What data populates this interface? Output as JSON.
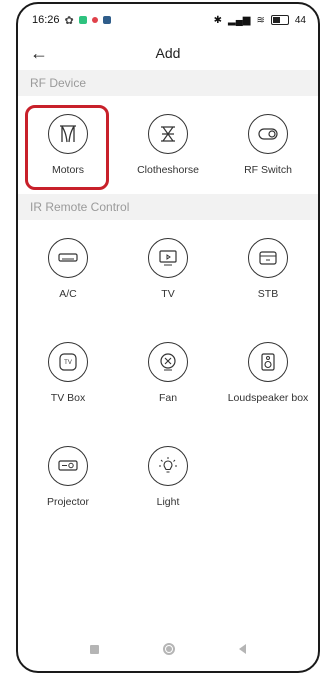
{
  "status_bar": {
    "time": "16:26",
    "battery": "44"
  },
  "header": {
    "back_icon": "arrow-left-icon",
    "title": "Add"
  },
  "rf_section": {
    "title": "RF Device",
    "items": [
      {
        "label": "Motors",
        "icon": "curtain-icon",
        "selected": true
      },
      {
        "label": "Clotheshorse",
        "icon": "clotheshorse-icon",
        "selected": false
      },
      {
        "label": "RF Switch",
        "icon": "switch-icon",
        "selected": false
      }
    ]
  },
  "ir_section": {
    "title": "IR Remote Control",
    "items": [
      {
        "label": "A/C",
        "icon": "ac-icon"
      },
      {
        "label": "TV",
        "icon": "tv-icon"
      },
      {
        "label": "STB",
        "icon": "stb-icon"
      },
      {
        "label": "TV Box",
        "icon": "tv-box-icon"
      },
      {
        "label": "Fan",
        "icon": "fan-icon"
      },
      {
        "label": "Loudspeaker box",
        "icon": "speaker-icon"
      },
      {
        "label": "Projector",
        "icon": "projector-icon"
      },
      {
        "label": "Light",
        "icon": "light-bulb-icon"
      }
    ]
  },
  "colors": {
    "highlight": "#c8202a",
    "section_bg": "#f2f2f2",
    "section_text": "#9a9a9a"
  }
}
